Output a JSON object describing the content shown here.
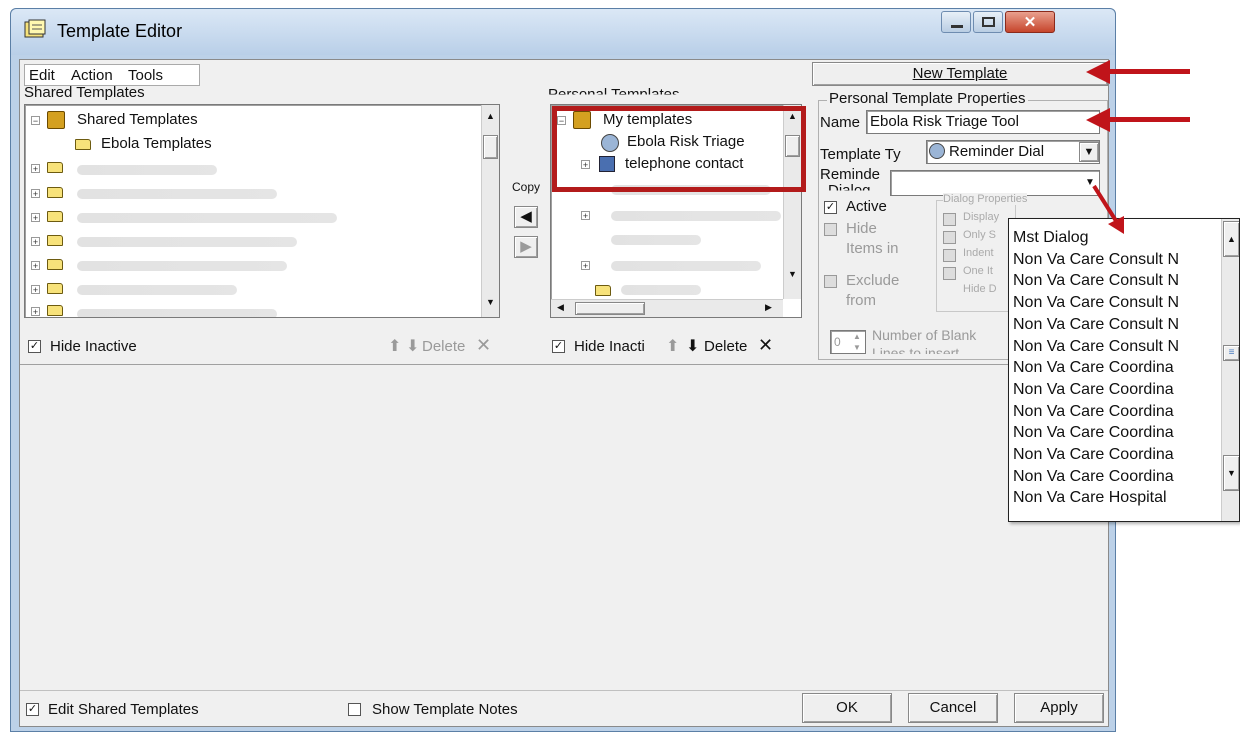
{
  "window": {
    "title": "Template Editor"
  },
  "menu": {
    "items": [
      "Edit",
      "Action",
      "Tools"
    ]
  },
  "shared": {
    "header": "Shared Templates",
    "root": "Shared Templates",
    "child": "Ebola Templates",
    "hide_inactive": "Hide Inactive",
    "delete": "Delete"
  },
  "copy_label": "Copy",
  "personal": {
    "header": "Personal Templates",
    "root": "My templates",
    "item1": "Ebola Risk Triage",
    "item2": "telephone contact",
    "hide_inactive": "Hide Inacti",
    "delete": "Delete"
  },
  "properties": {
    "new_template": "New Template",
    "group_title": "Personal Template Properties",
    "name_label": "Name",
    "name_value": "Ebola Risk Triage Tool",
    "type_label": "Template Ty",
    "type_value": "Reminder Dial",
    "reminder_label": "Reminde",
    "dialog_label": "Dialog",
    "active": "Active",
    "hide_items": [
      "Hide",
      "Items in"
    ],
    "exclude": [
      "Exclude",
      "from"
    ],
    "dialog_props_title": "Dialog Properties",
    "dialog_props": [
      "Display",
      "Only S",
      "Indent",
      "One It",
      "Hide D"
    ],
    "blank_lines_value": "0",
    "blank_lines_label": [
      "Number of Blank",
      "Lines to insert"
    ]
  },
  "dropdown": {
    "items": [
      "Mst Dialog",
      "Non Va Care Consult N",
      "Non Va Care Consult N",
      "Non Va Care Consult N",
      "Non Va Care Consult N",
      "Non Va Care Consult N",
      "Non Va Care Coordina",
      "Non Va Care Coordina",
      "Non Va Care Coordina",
      "Non Va Care Coordina",
      "Non Va Care Coordina",
      "Non Va Care Coordina",
      "Non Va Care Hospital"
    ]
  },
  "footer": {
    "edit_shared": "Edit Shared Templates",
    "show_notes": "Show Template Notes",
    "ok": "OK",
    "cancel": "Cancel",
    "apply": "Apply"
  },
  "colors": {
    "annotation": "#c0141a",
    "title_bar": "#b9cfe8"
  }
}
